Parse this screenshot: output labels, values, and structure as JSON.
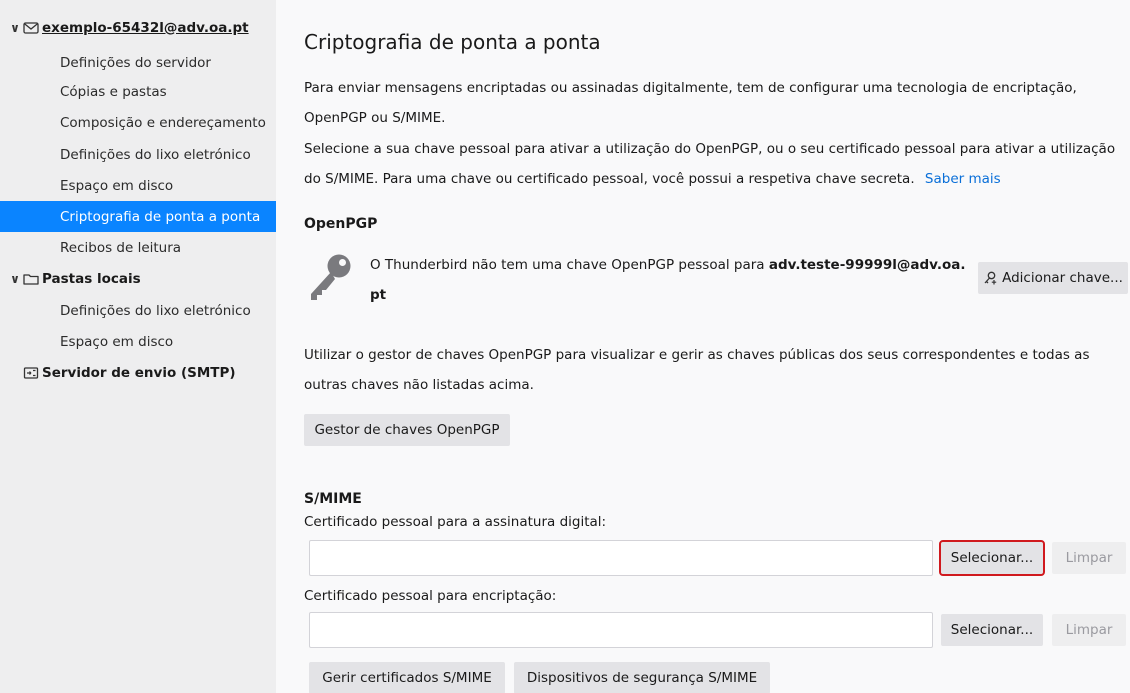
{
  "sidebar": {
    "account": {
      "label": "exemplo-65432l@adv.oa.pt",
      "twisty": "∨",
      "icon": "envelope-icon"
    },
    "account_items": [
      {
        "label": "Definições do servidor"
      },
      {
        "label": "Cópias e pastas"
      },
      {
        "label": "Composição e endereçamento"
      },
      {
        "label": "Definições do lixo eletrónico"
      },
      {
        "label": "Espaço em disco"
      },
      {
        "label": "Criptografia de ponta a ponta",
        "selected": true
      },
      {
        "label": "Recibos de leitura"
      }
    ],
    "local": {
      "label": "Pastas locais",
      "twisty": "∨",
      "icon": "folder-icon"
    },
    "local_items": [
      {
        "label": "Definições do lixo eletrónico"
      },
      {
        "label": "Espaço em disco"
      }
    ],
    "smtp": {
      "label": "Servidor de envio (SMTP)",
      "icon": "outbox-icon"
    }
  },
  "main": {
    "title": "Criptografia de ponta a ponta",
    "intro_line1": "Para enviar mensagens encriptadas ou assinadas digitalmente, tem de configurar uma tecnologia de encriptação,",
    "intro_line2": "OpenPGP ou S/MIME.",
    "select_line1": "Selecione a sua chave pessoal para ativar a utilização do OpenPGP, ou o seu certificado pessoal para ativar a utilização",
    "select_line2": "do S/MIME. Para uma chave ou certificado pessoal, você possui a respetiva chave secreta.",
    "learn_more": "Saber mais",
    "openpgp": {
      "heading": "OpenPGP",
      "no_key_text": "O Thunderbird não tem uma chave OpenPGP pessoal para ",
      "no_key_email": "adv.teste-99999l@adv.oa.pt",
      "add_key_button": "Adicionar chave...",
      "manager_line1": "Utilizar o gestor de chaves OpenPGP para visualizar e gerir as chaves públicas dos seus correspondentes e todas as",
      "manager_line2": "outras chaves não listadas acima.",
      "manager_button": "Gestor de chaves OpenPGP"
    },
    "smime": {
      "heading": "S/MIME",
      "sign_label": "Certificado pessoal para a assinatura digital:",
      "sign_value": "",
      "sign_select": "Selecionar...",
      "sign_clear": "Limpar",
      "enc_label": "Certificado pessoal para encriptação:",
      "enc_value": "",
      "enc_select": "Selecionar...",
      "enc_clear": "Limpar",
      "manage_certs": "Gerir certificados S/MIME",
      "security_devices": "Dispositivos de segurança S/MIME"
    }
  }
}
